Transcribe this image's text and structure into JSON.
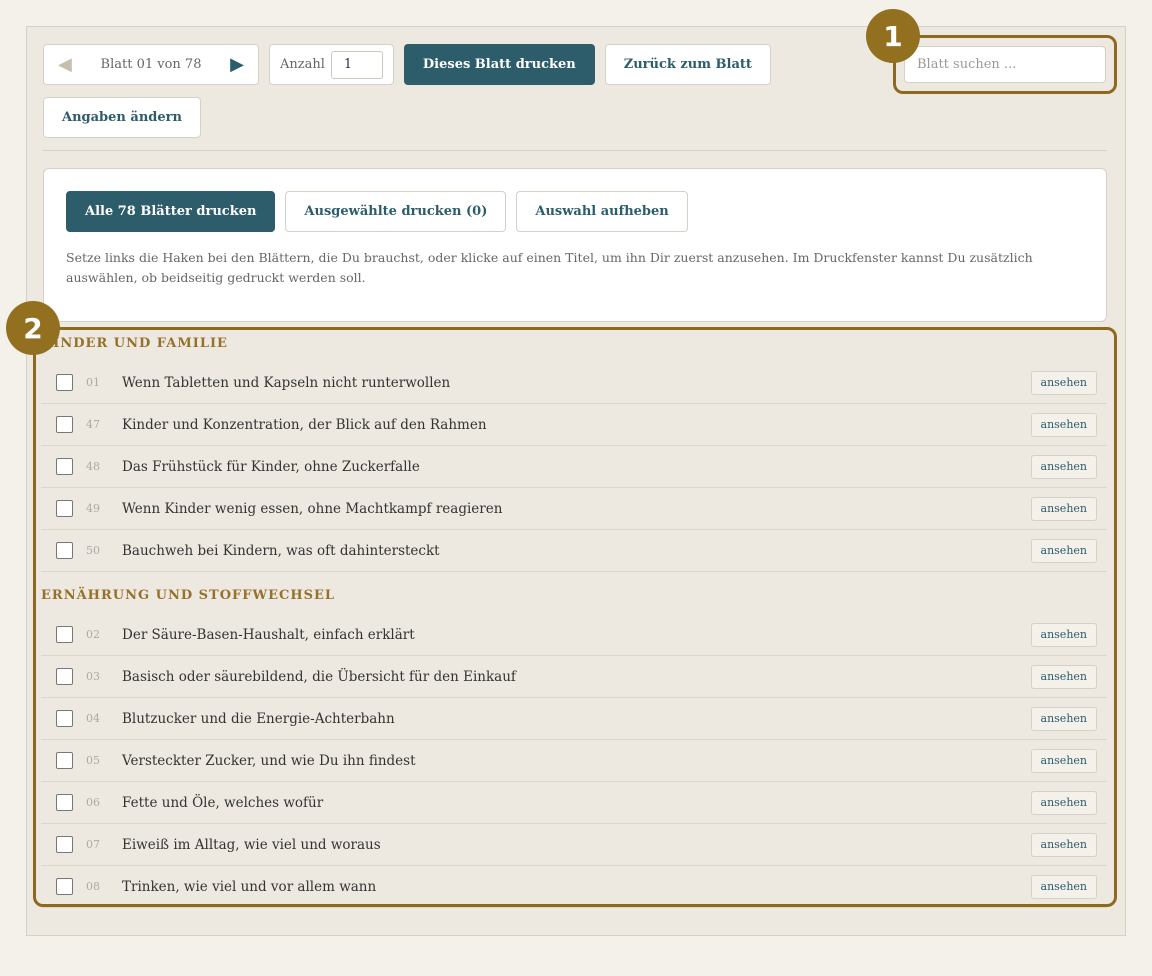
{
  "toolbar": {
    "prev_icon": "arrow-left-icon",
    "pager_label": "Blatt 01 von 78",
    "next_icon": "arrow-right-icon",
    "count_label": "Anzahl",
    "count_value": "1",
    "print_sheet": "Dieses Blatt drucken",
    "back_to_sheet": "Zurück zum Blatt",
    "edit_details": "Angaben ändern",
    "search_placeholder": "Blatt suchen ..."
  },
  "print_panel": {
    "print_all": "Alle 78 Blätter drucken",
    "print_selected": "Ausgewählte drucken (0)",
    "clear_selection": "Auswahl aufheben",
    "help": "Setze links die Haken bei den Blättern, die Du brauchst, oder klicke auf einen Titel, um ihn Dir zuerst anzusehen. Im Druckfenster kannst Du zusätzlich auswählen, ob beidseitig gedruckt werden soll."
  },
  "view_label": "ansehen",
  "sections": [
    {
      "title": "KINDER UND FAMILIE",
      "items": [
        {
          "num": "01",
          "title": "Wenn Tabletten und Kapseln nicht runterwollen"
        },
        {
          "num": "47",
          "title": "Kinder und Konzentration, der Blick auf den Rahmen"
        },
        {
          "num": "48",
          "title": "Das Frühstück für Kinder, ohne Zuckerfalle"
        },
        {
          "num": "49",
          "title": "Wenn Kinder wenig essen, ohne Machtkampf reagieren"
        },
        {
          "num": "50",
          "title": "Bauchweh bei Kindern, was oft dahintersteckt"
        }
      ]
    },
    {
      "title": "ERNÄHRUNG UND STOFFWECHSEL",
      "items": [
        {
          "num": "02",
          "title": "Der Säure-Basen-Haushalt, einfach erklärt"
        },
        {
          "num": "03",
          "title": "Basisch oder säurebildend, die Übersicht für den Einkauf"
        },
        {
          "num": "04",
          "title": "Blutzucker und die Energie-Achterbahn"
        },
        {
          "num": "05",
          "title": "Versteckter Zucker, und wie Du ihn findest"
        },
        {
          "num": "06",
          "title": "Fette und Öle, welches wofür"
        },
        {
          "num": "07",
          "title": "Eiweiß im Alltag, wie viel und woraus"
        },
        {
          "num": "08",
          "title": "Trinken, wie viel und vor allem wann"
        }
      ]
    }
  ],
  "badges": {
    "one": "1",
    "two": "2"
  },
  "colors": {
    "accent": "#2d5c6b",
    "highlight": "#8d6a1f",
    "section": "#96712a"
  }
}
